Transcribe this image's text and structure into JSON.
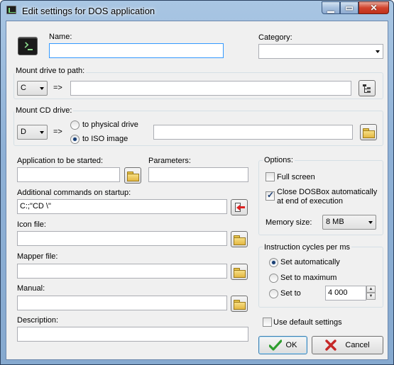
{
  "window": {
    "title": "Edit settings for DOS application"
  },
  "caption_buttons": {
    "minimize": "▁",
    "maximize": "▭",
    "close": "✕"
  },
  "general": {
    "name_label": "Name:",
    "name_value": "",
    "category_label": "Category:",
    "category_value": ""
  },
  "mount_drive": {
    "title": "Mount drive to path:",
    "drive": "C",
    "arrow_text": "=>",
    "path": ""
  },
  "mount_cd": {
    "title": "Mount CD drive:",
    "drive": "D",
    "arrow_text": "=>",
    "option_physical": "to physical drive",
    "option_iso": "to ISO image",
    "selected": "to ISO image",
    "image_path": ""
  },
  "application": {
    "app_label": "Application to be started:",
    "app_value": "",
    "params_label": "Parameters:",
    "params_value": "",
    "startup_label": "Additional commands on startup:",
    "startup_value": "C:;\"CD \\\"",
    "icon_label": "Icon file:",
    "icon_value": "",
    "mapper_label": "Mapper file:",
    "mapper_value": "",
    "manual_label": "Manual:",
    "manual_value": "",
    "description_label": "Description:",
    "description_value": ""
  },
  "options": {
    "title": "Options:",
    "full_screen_label": "Full screen",
    "full_screen_checked": false,
    "close_dosbox_label_line1": "Close DOSBox automatically",
    "close_dosbox_label_line2": "at end of execution",
    "close_dosbox_checked": true,
    "memory_label": "Memory size:",
    "memory_value": "8 MB"
  },
  "cycles": {
    "title": "Instruction cycles per ms",
    "option_auto": "Set automatically",
    "option_max": "Set to maximum",
    "option_set": "Set to",
    "selected": "Set automatically",
    "value": "4 000"
  },
  "footer": {
    "use_default_label": "Use default settings",
    "use_default_checked": false,
    "ok_label": "OK",
    "cancel_label": "Cancel"
  },
  "colors": {
    "titlebar": "#a9c6e3",
    "ok_check": "#2e9d2e",
    "cancel_x": "#c62828",
    "focus_border": "#3399ff"
  }
}
